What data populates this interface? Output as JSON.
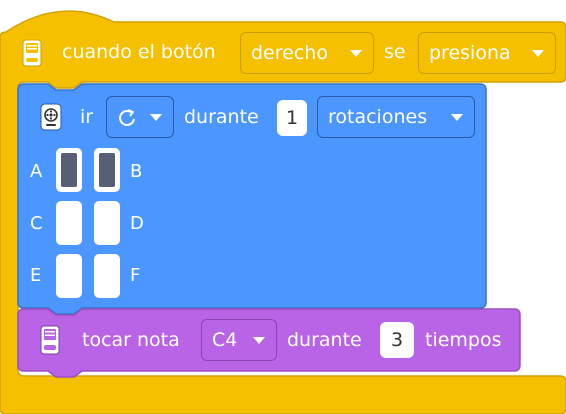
{
  "hat_block": {
    "when_text": "cuando el botón",
    "button_value": "derecho",
    "se_text": "se",
    "action_value": "presiona",
    "icon": "brain-icon"
  },
  "motor_block": {
    "ir_text": "ir",
    "direction_icon": "clockwise-arrow-icon",
    "during_text": "durante",
    "amount": "1",
    "unit_value": "rotaciones",
    "icon": "motor-icon",
    "ports": [
      {
        "left": "A",
        "right": "B",
        "left_on": true,
        "right_on": true
      },
      {
        "left": "C",
        "right": "D",
        "left_on": false,
        "right_on": false
      },
      {
        "left": "E",
        "right": "F",
        "left_on": false,
        "right_on": false
      }
    ]
  },
  "sound_block": {
    "play_text": "tocar nota",
    "note_value": "C4",
    "during_text": "durante",
    "beats": "3",
    "beats_text": "tiempos",
    "icon": "brain-icon"
  },
  "colors": {
    "hat": "#f5c000",
    "hat_dark": "#d4a100",
    "motor": "#4c97ff",
    "motor_dark": "#3373cc",
    "sound": "#b964e6",
    "sound_dark": "#9950c2"
  }
}
